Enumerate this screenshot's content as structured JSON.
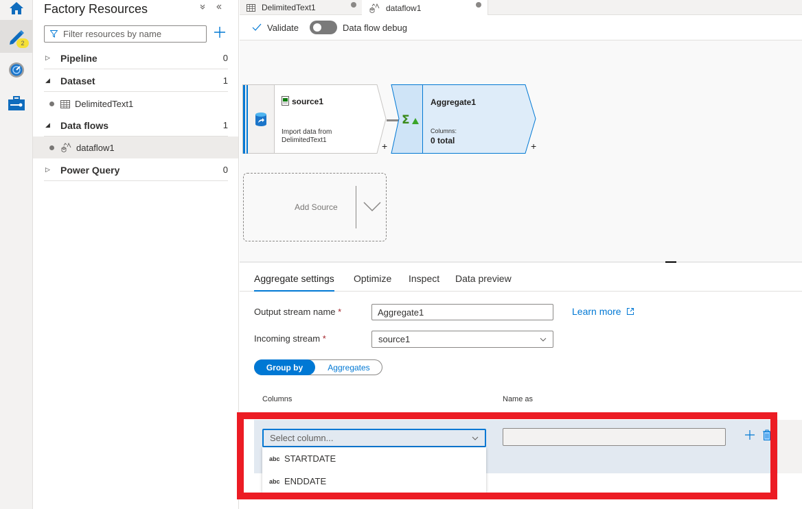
{
  "rail": {
    "items": [
      {
        "icon": "home-icon"
      },
      {
        "icon": "pencil-icon",
        "badge": "2",
        "active": true
      },
      {
        "icon": "monitor-icon"
      },
      {
        "icon": "toolbox-icon"
      }
    ]
  },
  "resources": {
    "title": "Factory Resources",
    "collapse_all": "»",
    "hide_pane": "«",
    "filter_placeholder": "Filter resources by name",
    "groups": [
      {
        "label": "Pipeline",
        "count": "0",
        "expanded": false,
        "children": []
      },
      {
        "label": "Dataset",
        "count": "1",
        "expanded": true,
        "children": [
          {
            "label": "DelimitedText1",
            "icon": "table-icon"
          }
        ]
      },
      {
        "label": "Data flows",
        "count": "1",
        "expanded": true,
        "children": [
          {
            "label": "dataflow1",
            "icon": "dataflow-icon",
            "selected": true
          }
        ]
      },
      {
        "label": "Power Query",
        "count": "0",
        "expanded": false,
        "children": []
      }
    ]
  },
  "tabs": [
    {
      "label": "DelimitedText1",
      "icon": "table-icon",
      "unsaved": true,
      "active": false
    },
    {
      "label": "dataflow1",
      "icon": "dataflow-icon",
      "unsaved": true,
      "active": true
    }
  ],
  "toolbar": {
    "validate_label": "Validate",
    "debug_label": "Data flow debug",
    "debug_on": false
  },
  "canvas": {
    "source_node": {
      "name": "source1",
      "description_line1": "Import data from",
      "description_line2": "DelimitedText1"
    },
    "aggregate_node": {
      "name": "Aggregate1",
      "columns_label": "Columns:",
      "columns_value": "0 total"
    },
    "add_source_label": "Add Source",
    "plus": "+"
  },
  "panel": {
    "tabs": [
      {
        "label": "Aggregate settings",
        "active": true
      },
      {
        "label": "Optimize"
      },
      {
        "label": "Inspect"
      },
      {
        "label": "Data preview"
      }
    ],
    "output_stream_label": "Output stream name",
    "output_stream_value": "Aggregate1",
    "incoming_stream_label": "Incoming stream",
    "incoming_stream_value": "source1",
    "required_mark": "*",
    "learn_more": "Learn more",
    "pivot": {
      "selected": "Group by",
      "other": "Aggregates"
    },
    "columns_header": "Columns",
    "name_as_header": "Name as",
    "column_select_placeholder": "Select column...",
    "column_options": [
      {
        "type": "abc",
        "name": "STARTDATE"
      },
      {
        "type": "abc",
        "name": "ENDDATE"
      }
    ],
    "name_as_value": ""
  },
  "colors": {
    "accent": "#0078d4",
    "highlight": "#ec1c24",
    "badge": "#fce100",
    "aggregate_fill": "#deecf9"
  }
}
